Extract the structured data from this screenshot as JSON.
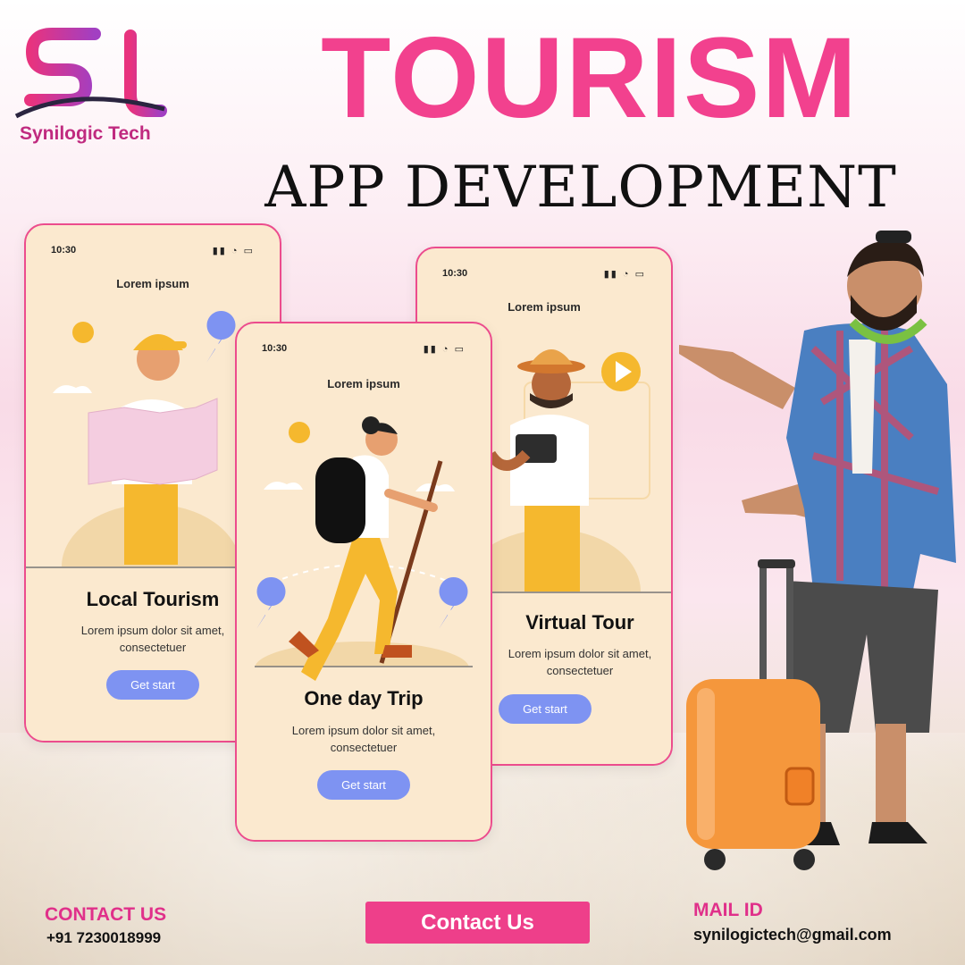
{
  "brand": {
    "name": "Synilogic Tech",
    "monogram": "ST"
  },
  "headline": {
    "title": "TOURISM",
    "subtitle": "APP DEVELOPMENT"
  },
  "phones": [
    {
      "time": "10:30",
      "screen_title": "Lorem ipsum",
      "heading": "Local Tourism",
      "desc_line1": "Lorem ipsum dolor sit amet,",
      "desc_line2": "consectetuer",
      "button": "Get start"
    },
    {
      "time": "10:30",
      "screen_title": "Lorem ipsum",
      "heading": "One day Trip",
      "desc_line1": "Lorem ipsum dolor sit amet,",
      "desc_line2": "consectetuer",
      "button": "Get start"
    },
    {
      "time": "10:30",
      "screen_title": "Lorem ipsum",
      "heading": "Virtual Tour",
      "desc_line1": "Lorem ipsum dolor sit amet,",
      "desc_line2": "consectetuer",
      "button": "Get start"
    }
  ],
  "contact": {
    "label": "CONTACT US",
    "phone": "+91 7230018999",
    "button": "Contact Us"
  },
  "mail": {
    "label": "MAIL ID",
    "address": "synilogictech@gmail.com"
  },
  "colors": {
    "pink": "#f2418e",
    "button_blue": "#7e93f2",
    "phone_bg": "#fbe9cf",
    "accent_yellow": "#f5b82e"
  },
  "icons": [
    "signal-icon",
    "wifi-icon",
    "battery-icon",
    "location-pin-icon",
    "play-icon"
  ]
}
